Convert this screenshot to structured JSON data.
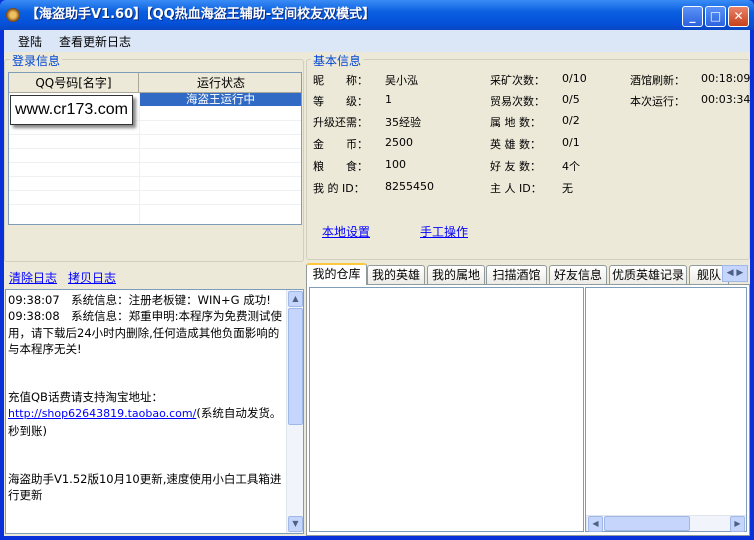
{
  "window": {
    "title": "【海盗助手V1.60】【QQ热血海盗王辅助-空间校友双模式】"
  },
  "menu": [
    "登陆",
    "查看更新日志"
  ],
  "login": {
    "legend": "登录信息",
    "columns": [
      "QQ号码[名字]",
      "运行状态"
    ],
    "rows": [
      {
        "name": "",
        "status": "海盗王运行中"
      }
    ],
    "watermark": "www.cr173.com"
  },
  "basic": {
    "legend": "基本信息",
    "col1": [
      {
        "label": "昵　　称：",
        "value": "吴小泓"
      },
      {
        "label": "等　　级：",
        "value": "1"
      },
      {
        "label": "升级还需：",
        "value": "35经验"
      },
      {
        "label": "金　　币：",
        "value": "2500"
      },
      {
        "label": "粮　　食：",
        "value": "100"
      },
      {
        "label": "我 的 ID：",
        "value": "8255450"
      }
    ],
    "col2": [
      {
        "label": "采矿次数：",
        "value": "0/10"
      },
      {
        "label": "贸易次数：",
        "value": "0/5"
      },
      {
        "label": "属 地 数：",
        "value": "0/2"
      },
      {
        "label": "英 雄 数：",
        "value": "0/1"
      },
      {
        "label": "好 友 数：",
        "value": "4个"
      },
      {
        "label": "主 人 ID：",
        "value": "无"
      }
    ],
    "col3": [
      {
        "label": "酒馆刷新：",
        "value": "00:18:09"
      },
      {
        "label": "本次运行：",
        "value": "00:03:34"
      }
    ],
    "links": [
      "本地设置",
      "手工操作"
    ]
  },
  "log": {
    "links": [
      "清除日志",
      "拷贝日志"
    ],
    "lines": [
      "09:38:07　系统信息：注册老板键：WIN+G 成功!",
      "09:38:08　系统信息：郑重申明:本程序为免费测试使用，请下载后24小时内删除,任何造成其他负面影响的与本程序无关!",
      "充值QB话费请支持淘宝地址："
    ],
    "url": "http://shop62643819.taobao.com/",
    "url_suffix": "(系统自动发货。秒到账)",
    "update": "海盗助手V1.52版10月10更新,速度使用小白工具箱进行更新"
  },
  "tabs": [
    "我的仓库",
    "我的英雄",
    "我的属地",
    "扫描酒馆",
    "好友信息",
    "优质英雄记录",
    "舰队"
  ]
}
